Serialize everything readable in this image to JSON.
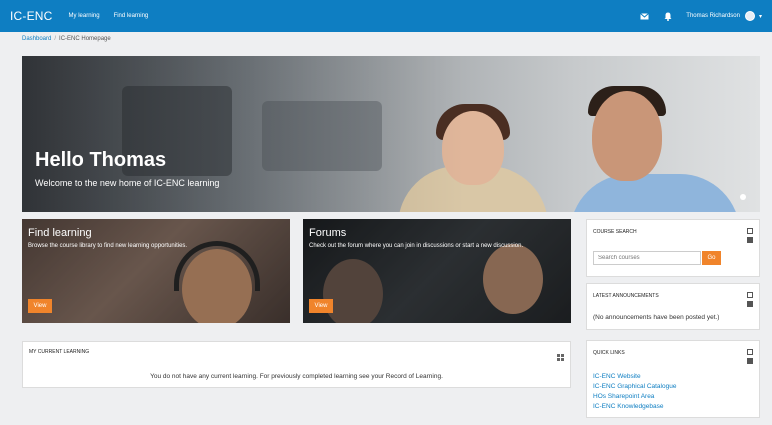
{
  "navbar": {
    "brand": "IC-ENC",
    "links": [
      "My learning",
      "Find learning"
    ],
    "user_name": "Thomas Richardson",
    "icons": [
      "envelope-icon",
      "bell-icon",
      "avatar",
      "caret-down-icon"
    ],
    "accent": "#0e7ec2"
  },
  "breadcrumb": {
    "home": "Dashboard",
    "current": "IC-ENC Homepage"
  },
  "hero": {
    "title": "Hello Thomas",
    "subtitle": "Welcome to the new home of IC-ENC learning"
  },
  "tiles": [
    {
      "title": "Find learning",
      "description": "Browse the course library to find new learning opportunities.",
      "button": "View"
    },
    {
      "title": "Forums",
      "description": "Check out the forum where you can join in discussions or start a new discussion.",
      "button": "View"
    }
  ],
  "current_learning": {
    "title": "MY CURRENT LEARNING",
    "message": "You do not have any current learning. For previously completed learning see your Record of Learning."
  },
  "course_search": {
    "title": "COURSE SEARCH",
    "placeholder": "Search courses",
    "button": "Go"
  },
  "announcements": {
    "title": "LATEST ANNOUNCEMENTS",
    "text": "(No announcements have been posted yet.)"
  },
  "quick_links": {
    "title": "QUICK LINKS",
    "items": [
      "IC-ENC Website",
      "IC-ENC Graphical Catalogue",
      "HOs Sharepoint Area",
      "IC-ENC Knowledgebase"
    ]
  },
  "colors": {
    "primary": "#0e7ec2",
    "button": "#f0842b"
  }
}
